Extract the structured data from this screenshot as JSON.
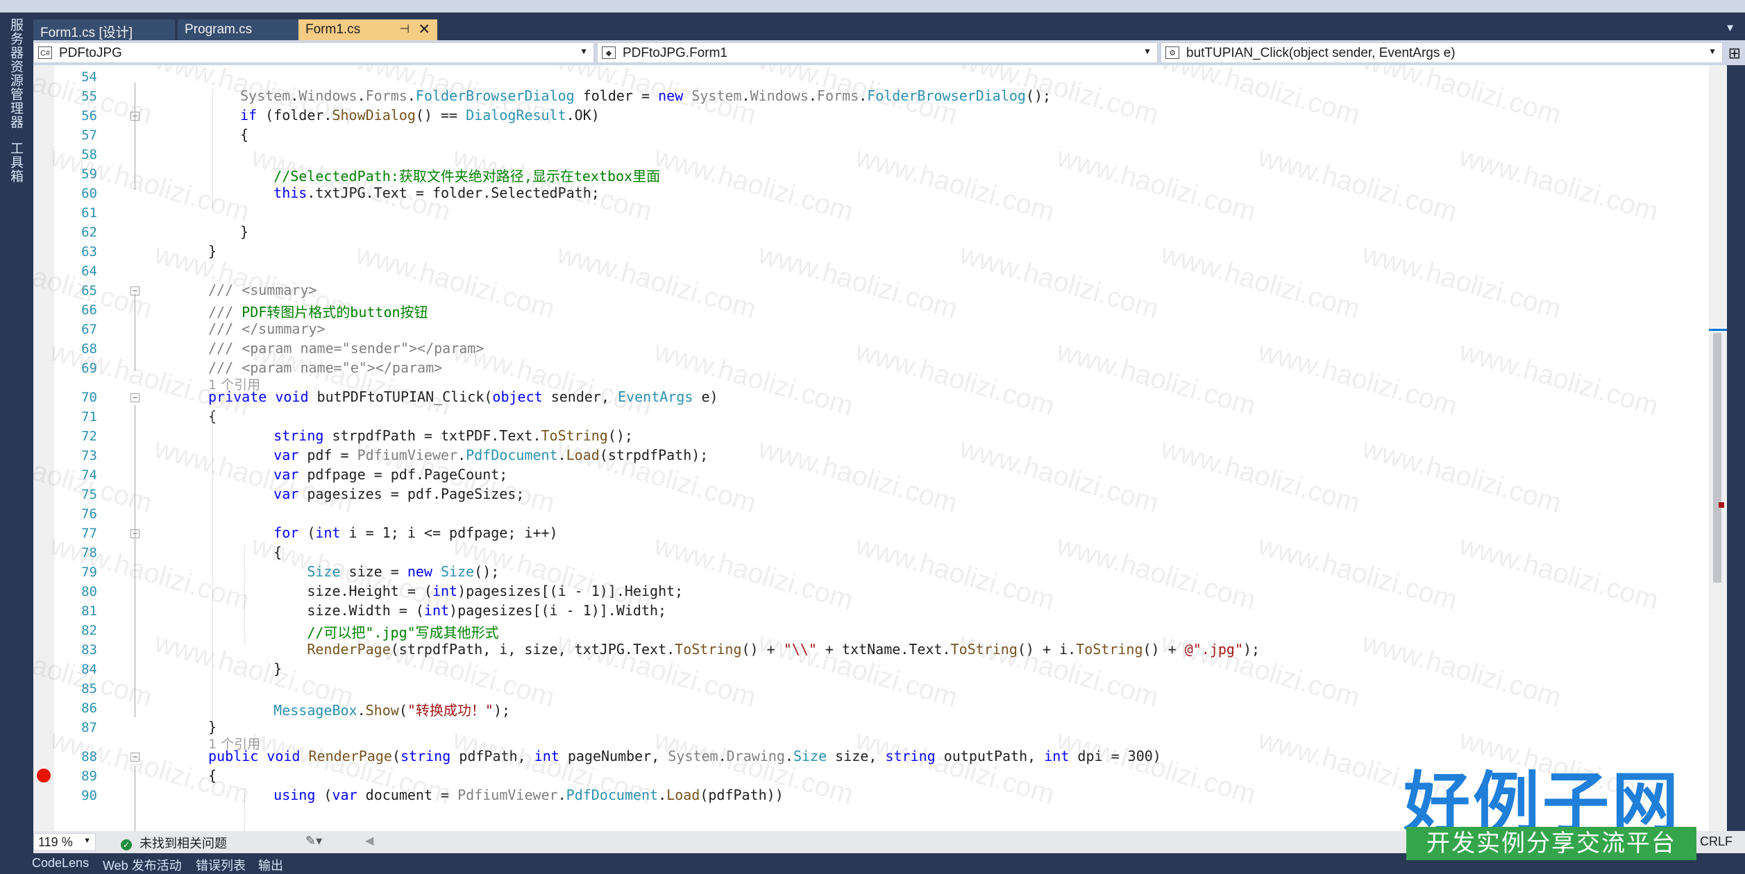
{
  "left_strip": {
    "tabs": [
      "服务器资源管理器",
      "工具箱"
    ]
  },
  "tabs": [
    {
      "label": "Form1.cs [设计]"
    },
    {
      "label": "Program.cs"
    },
    {
      "label": "Form1.cs",
      "active": true
    }
  ],
  "tab_icons": {
    "pin": "pin-icon",
    "close": "close-icon",
    "overflow": "chevron-down-icon"
  },
  "nav": {
    "project": "PDFtoJPG",
    "class": "PDFtoJPG.Form1",
    "member": "butTUPIAN_Click(object sender, EventArgs e)"
  },
  "editor": {
    "line_numbers": [
      "54",
      "55",
      "56",
      "57",
      "58",
      "59",
      "60",
      "61",
      "62",
      "63",
      "64",
      "65",
      "66",
      "67",
      "68",
      "69",
      "70",
      "71",
      "72",
      "73",
      "74",
      "75",
      "76",
      "77",
      "78",
      "79",
      "80",
      "81",
      "82",
      "83",
      "84",
      "85",
      "86",
      "87",
      "88",
      "89",
      "90"
    ],
    "lines": [
      "",
      "System.Windows.Forms.FolderBrowserDialog folder = new System.Windows.Forms.FolderBrowserDialog();",
      "if (folder.ShowDialog() == DialogResult.OK)",
      "{",
      "",
      "    //SelectedPath:获取文件夹绝对路径,显示在textbox里面",
      "    this.txtJPG.Text = folder.SelectedPath;",
      "",
      "}",
      "}",
      "",
      "/// <summary>",
      "/// PDF转图片格式的button按钮",
      "/// </summary>",
      "/// <param name=\"sender\"></param>",
      "/// <param name=\"e\"></param>",
      "private void butPDFtoTUPIAN_Click(object sender, EventArgs e)",
      "{",
      "    string strpdfPath = txtPDF.Text.ToString();",
      "    var pdf = PdfiumViewer.PdfDocument.Load(strpdfPath);",
      "    var pdfpage = pdf.PageCount;",
      "    var pagesizes = pdf.PageSizes;",
      "",
      "    for (int i = 1; i <= pdfpage; i++)",
      "    {",
      "        Size size = new Size();",
      "        size.Height = (int)pagesizes[(i - 1)].Height;",
      "        size.Width = (int)pagesizes[(i - 1)].Width;",
      "        //可以把\".jpg\"写成其他形式",
      "        RenderPage(strpdfPath, i, size, txtJPG.Text.ToString() + \"\\\\\" + txtName.Text.ToString() + i.ToString() + @\".jpg\");",
      "    }",
      "",
      "    MessageBox.Show(\"转换成功！\");",
      "}",
      "public void RenderPage(string pdfPath, int pageNumber, System.Drawing.Size size, string outputPath, int dpi = 300)",
      "{",
      "    using (var document = PdfiumViewer.PdfDocument.Load(pdfPath))"
    ],
    "codelens": [
      "1 个引用",
      "1 个引用"
    ],
    "watermark": "www.haolizi.com"
  },
  "status": {
    "zoom": "119 %",
    "issues": "未找到相关问题",
    "line_ending": "CRLF"
  },
  "bottom_tabs": [
    "CodeLens",
    "Web 发布活动",
    "错误列表",
    "输出"
  ],
  "logo": {
    "title": "好例子网",
    "subtitle": "开发实例分享交流平台"
  },
  "colors": {
    "keyword": "#0000ff",
    "type": "#2b91af",
    "comment": "#008000",
    "string": "#a31515",
    "active_tab": "#f5cc84",
    "chrome": "#293955",
    "breakpoint": "#e51400"
  }
}
